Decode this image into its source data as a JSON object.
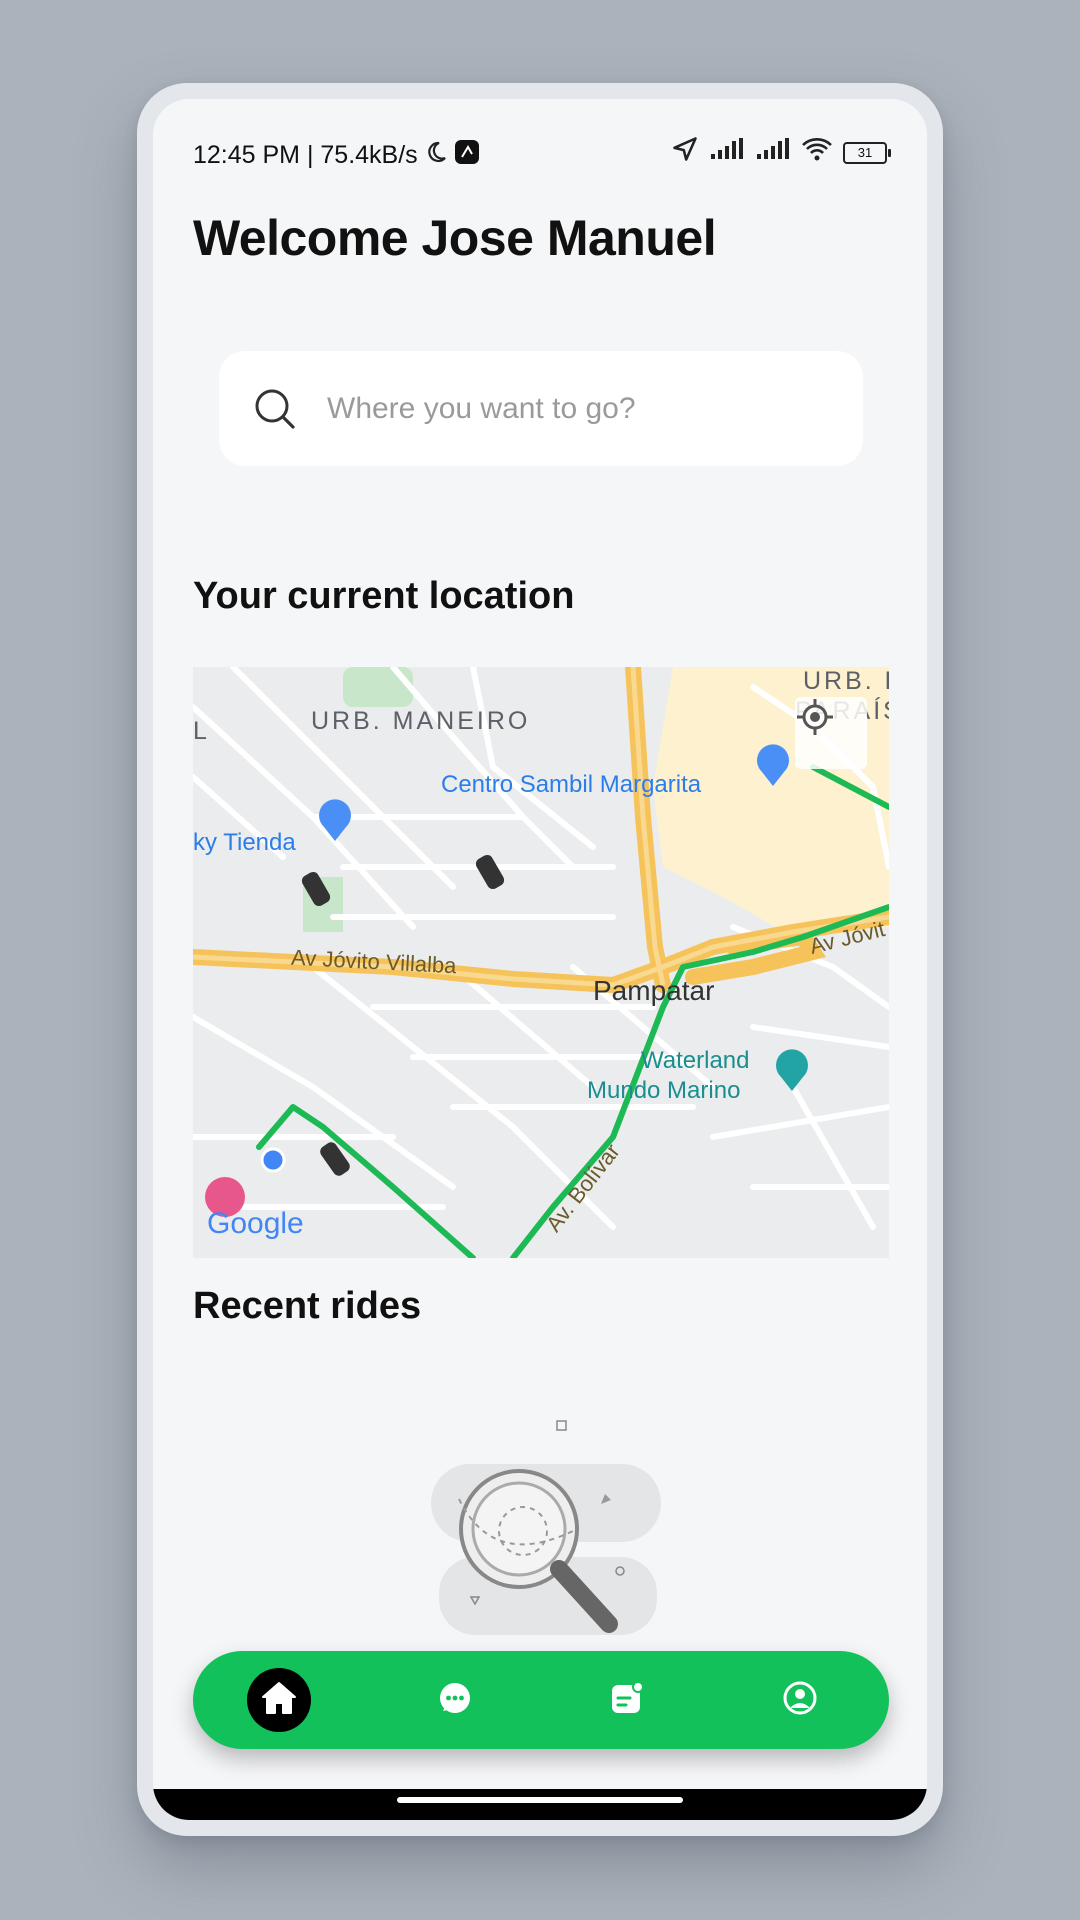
{
  "status_bar": {
    "time_speed": "12:45 PM | 75.4kB/s",
    "battery": "31"
  },
  "header": {
    "title": "Welcome Jose Manuel"
  },
  "search": {
    "placeholder": "Where you want to go?"
  },
  "sections": {
    "location_title": "Your current location",
    "recent_title": "Recent rides"
  },
  "map": {
    "labels": {
      "urb_maneiro": "URB. MANEIRO",
      "urb_paraiso_1": "URB. E",
      "urb_paraiso_2": "PARAÍS",
      "edge_l": "L",
      "centro_sambil": "Centro Sambil Margarita",
      "tienda": "ky Tienda",
      "av_jovito": "Av Jóvito Villalba",
      "av_jovit_right": "Av Jóvit",
      "pampatar": "Pampatar",
      "waterland_1": "Waterland",
      "waterland_2": "Mundo Marino",
      "av_bolivar": "Av. Bolívar",
      "google": "Google"
    }
  },
  "nav": {
    "items": [
      "home",
      "chat",
      "notes",
      "profile"
    ],
    "active": "home"
  },
  "colors": {
    "accent_green": "#12c15a",
    "route_green": "#1db954",
    "road_yellow": "#f6c25a",
    "poi_blue": "#2b7de9"
  }
}
